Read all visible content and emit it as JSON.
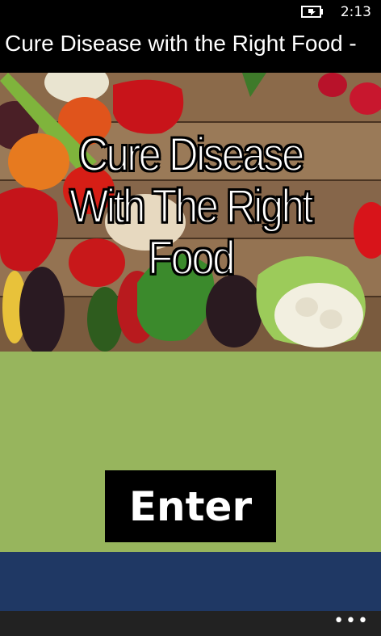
{
  "status_bar": {
    "time": "2:13",
    "battery_icon": "battery-charging-icon"
  },
  "app": {
    "title": "Cure Disease with the Right Food -"
  },
  "hero": {
    "title_line1": "Cure Disease",
    "title_line2": "With The Right Food",
    "image": "vegetables-on-wooden-table"
  },
  "main": {
    "enter_label": "Enter",
    "panel_color": "#97b55d",
    "band_color": "#1f3864"
  },
  "app_bar": {
    "more_label": "•••",
    "more_icon": "ellipsis-icon"
  }
}
